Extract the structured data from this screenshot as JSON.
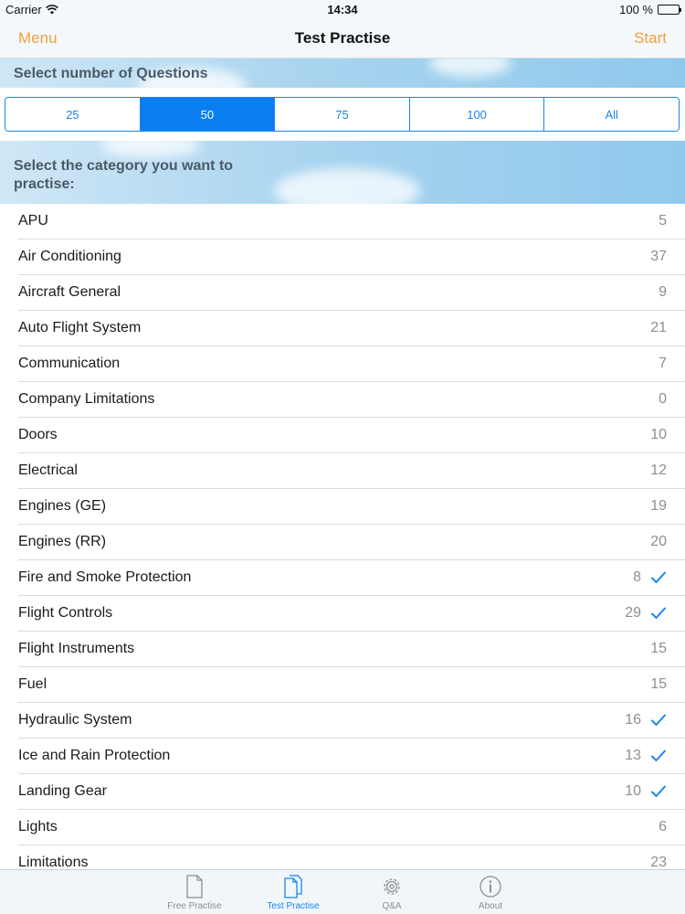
{
  "status_bar": {
    "carrier": "Carrier",
    "time": "14:34",
    "battery": "100 %"
  },
  "nav": {
    "left": "Menu",
    "title": "Test Practise",
    "right": "Start"
  },
  "questions_header": "Select number of Questions",
  "question_options": [
    "25",
    "50",
    "75",
    "100",
    "All"
  ],
  "selected_option": "50",
  "category_header": "Select the category you want to practise:",
  "categories": [
    {
      "name": "APU",
      "count": "5",
      "checked": false
    },
    {
      "name": "Air Conditioning",
      "count": "37",
      "checked": false
    },
    {
      "name": "Aircraft General",
      "count": "9",
      "checked": false
    },
    {
      "name": "Auto Flight System",
      "count": "21",
      "checked": false
    },
    {
      "name": "Communication",
      "count": "7",
      "checked": false
    },
    {
      "name": "Company Limitations",
      "count": "0",
      "checked": false
    },
    {
      "name": "Doors",
      "count": "10",
      "checked": false
    },
    {
      "name": "Electrical",
      "count": "12",
      "checked": false
    },
    {
      "name": "Engines (GE)",
      "count": "19",
      "checked": false
    },
    {
      "name": "Engines (RR)",
      "count": "20",
      "checked": false
    },
    {
      "name": "Fire and Smoke Protection",
      "count": "8",
      "checked": true
    },
    {
      "name": "Flight Controls",
      "count": "29",
      "checked": true
    },
    {
      "name": "Flight Instruments",
      "count": "15",
      "checked": false
    },
    {
      "name": "Fuel",
      "count": "15",
      "checked": false
    },
    {
      "name": "Hydraulic System",
      "count": "16",
      "checked": true
    },
    {
      "name": "Ice and Rain Protection",
      "count": "13",
      "checked": true
    },
    {
      "name": "Landing Gear",
      "count": "10",
      "checked": true
    },
    {
      "name": "Lights",
      "count": "6",
      "checked": false
    },
    {
      "name": "Limitations",
      "count": "23",
      "checked": false
    }
  ],
  "tabs": [
    {
      "label": "Free Practise",
      "icon": "document-icon",
      "active": false
    },
    {
      "label": "Test Practise",
      "icon": "documents-icon",
      "active": true
    },
    {
      "label": "Q&A",
      "icon": "gear-icon",
      "active": false
    },
    {
      "label": "About",
      "icon": "info-icon",
      "active": false
    }
  ],
  "colors": {
    "accent": "#1a86e8",
    "nav_action": "#f0a040",
    "selected_segment": "#0a7ff0"
  }
}
